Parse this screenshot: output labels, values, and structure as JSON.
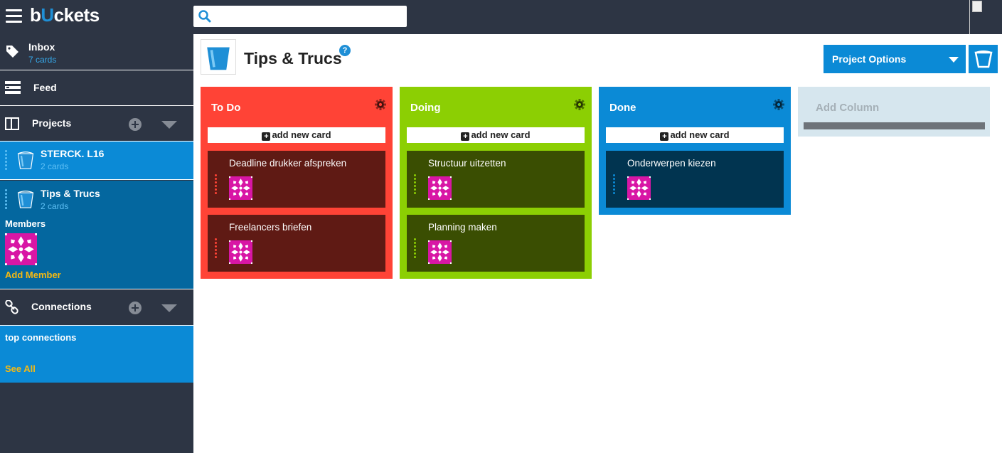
{
  "app": {
    "logo": "buckets",
    "logo_pre": "b",
    "logo_u": "U",
    "logo_post": "ckets"
  },
  "search": {
    "placeholder": ""
  },
  "sidebar": {
    "inbox": {
      "label": "Inbox",
      "count": "7 cards"
    },
    "feed": {
      "label": "Feed"
    },
    "projects": {
      "label": "Projects"
    },
    "project_list": [
      {
        "name": "STERCK. L16",
        "count": "2 cards"
      },
      {
        "name": "Tips & Trucs",
        "count": "2 cards"
      }
    ],
    "members_label": "Members",
    "add_member": "Add Member",
    "connections": {
      "label": "Connections"
    },
    "top_connections": "top connections",
    "see_all": "See All"
  },
  "project": {
    "title": "Tips & Trucs",
    "help": "?",
    "options_label": "Project Options"
  },
  "columns": [
    {
      "title": "To Do",
      "add_label": "add new card",
      "color": "#ff4336",
      "card_color": "#5f1a14",
      "dot_color": "#ff4336",
      "cards": [
        {
          "title": "Deadline drukker afspreken"
        },
        {
          "title": "Freelancers briefen"
        }
      ]
    },
    {
      "title": "Doing",
      "add_label": "add new card",
      "color": "#8ccf03",
      "card_color": "#3a4e02",
      "dot_color": "#8ccf03",
      "cards": [
        {
          "title": "Structuur uitzetten"
        },
        {
          "title": "Planning maken"
        }
      ]
    },
    {
      "title": "Done",
      "add_label": "add new card",
      "color": "#0b8ad6",
      "card_color": "#013450",
      "dot_color": "#0b8ad6",
      "cards": [
        {
          "title": "Onderwerpen kiezen"
        }
      ]
    }
  ],
  "add_column": {
    "label": "Add Column"
  },
  "colors": {
    "topbar": "#2d3544",
    "sidebar_selected": "#0b8ad6",
    "accent_link": "#f5b912",
    "member_avatar": "#d816a5"
  }
}
